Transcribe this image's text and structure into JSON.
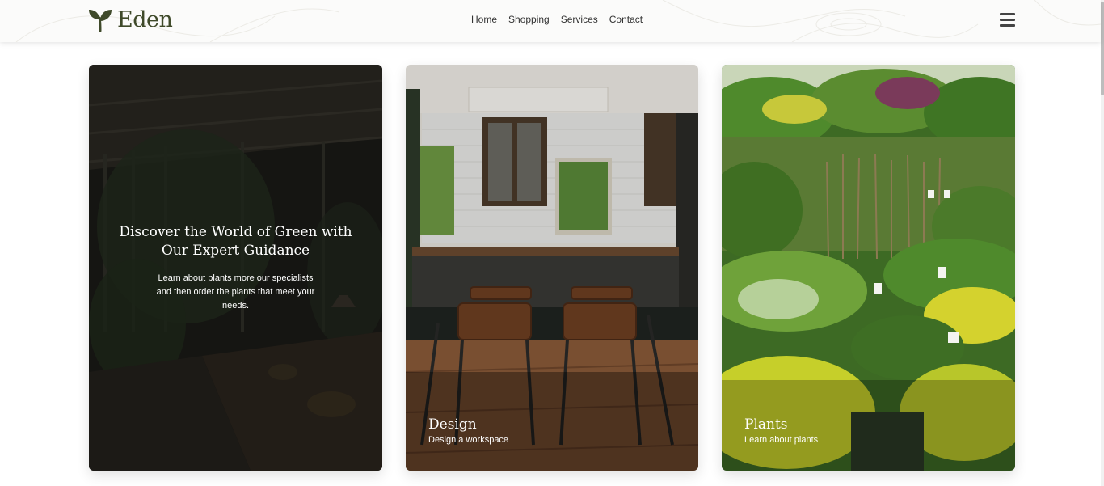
{
  "brand": {
    "name": "Eden",
    "icon": "leaf-sprout-icon",
    "color": "#3f4a2a"
  },
  "nav": {
    "items": [
      "Home",
      "Shopping",
      "Services",
      "Contact"
    ]
  },
  "menu": {
    "icon": "hamburger-menu-icon"
  },
  "hero": {
    "title": "Discover the World of Green with Our Expert Guidance",
    "description": "Learn about plants more our specialists and then order the plants that meet your needs."
  },
  "cards": [
    {
      "title": "Design",
      "subtitle": "Design a workspace"
    },
    {
      "title": "Plants",
      "subtitle": "Learn about plants"
    }
  ]
}
